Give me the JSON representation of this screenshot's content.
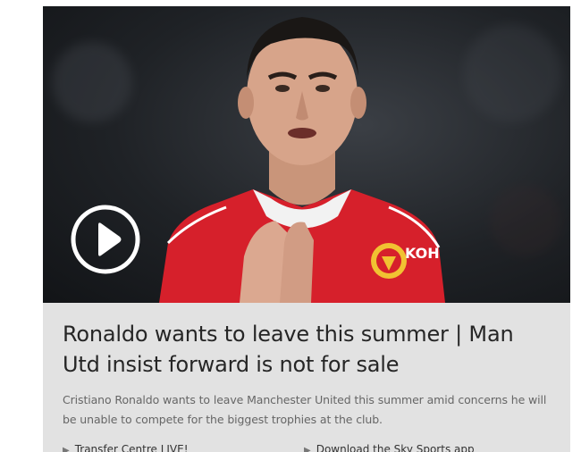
{
  "article": {
    "headline": "Ronaldo wants to leave this summer | Man Utd insist forward is not for sale",
    "summary": "Cristiano Ronaldo wants to leave Manchester United this summer amid concerns he will be unable to compete for the biggest trophies at the club.",
    "media": {
      "play_icon": "play-circle-icon",
      "shirt_sponsor_text": "KOH"
    }
  },
  "related_links": [
    {
      "label": "Transfer Centre LIVE!",
      "icon": "chevron-right-icon"
    },
    {
      "label": "Download the Sky Sports app",
      "icon": "chevron-right-icon"
    }
  ],
  "colors": {
    "card_background": "#e2e2e2",
    "headline": "#262626",
    "summary": "#666666",
    "kit_red": "#d6202b"
  }
}
